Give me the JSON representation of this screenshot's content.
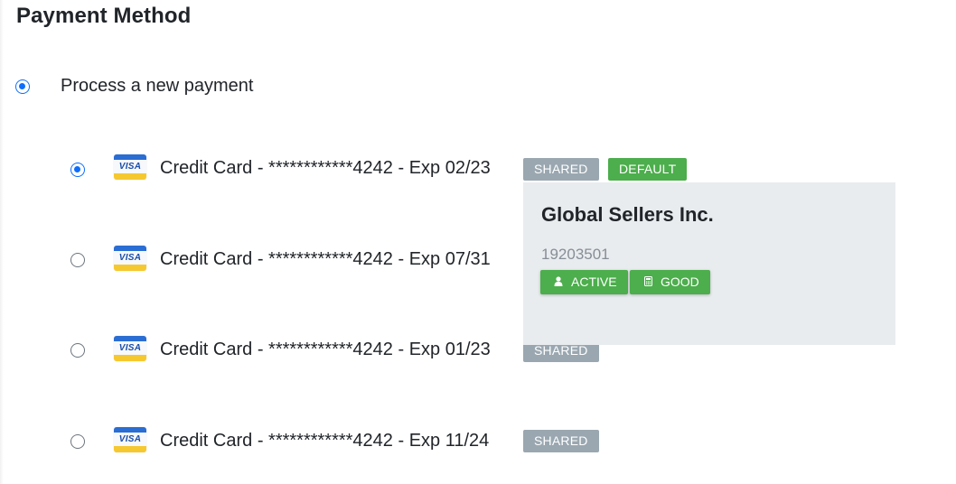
{
  "title": "Payment Method",
  "new_payment": {
    "label": "Process a new payment",
    "selected": true
  },
  "cards": [
    {
      "brand": "VISA",
      "label": "Credit Card - ************4242 - Exp 02/23",
      "selected": true,
      "badges": [
        "SHARED",
        "DEFAULT"
      ]
    },
    {
      "brand": "VISA",
      "label": "Credit Card - ************4242 - Exp 07/31",
      "selected": false,
      "badges": []
    },
    {
      "brand": "VISA",
      "label": "Credit Card - ************4242 - Exp 01/23",
      "selected": false,
      "badges": [
        "SHARED"
      ]
    },
    {
      "brand": "VISA",
      "label": "Credit Card - ************4242 - Exp 11/24",
      "selected": false,
      "badges": [
        "SHARED"
      ]
    }
  ],
  "popover": {
    "name": "Global Sellers Inc.",
    "id": "19203501",
    "badges": [
      {
        "icon": "user-icon",
        "label": "ACTIVE"
      },
      {
        "icon": "calculator-icon",
        "label": "GOOD"
      }
    ]
  },
  "colors": {
    "accent": "#0d6efd",
    "badge_shared": "#9aa7b0",
    "badge_success": "#4cae4c",
    "popover_bg": "#e9ecef"
  }
}
